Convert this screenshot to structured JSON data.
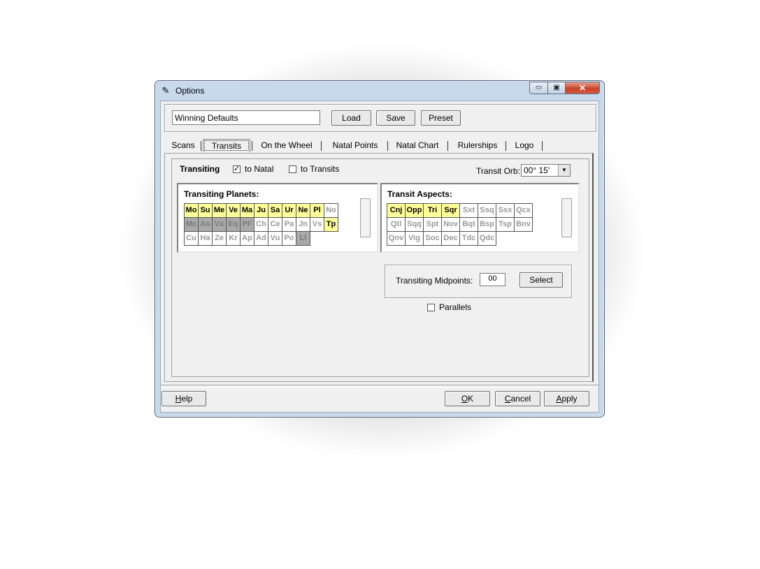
{
  "window": {
    "title": "Options",
    "app_icon": "✎",
    "controls": {
      "minimize": "▭",
      "maximize": "▣",
      "close": "✕"
    }
  },
  "profile": {
    "name_value": "Winning Defaults",
    "load_label": "Load",
    "save_label": "Save",
    "preset_label": "Preset"
  },
  "tabs": [
    "Scans",
    "Transits",
    "On the Wheel",
    "Natal Points",
    "Natal Chart",
    "Rulerships",
    "Logo"
  ],
  "active_tab": "Transits",
  "transits": {
    "transiting_label": "Transiting",
    "to_natal_label": "to Natal",
    "to_natal_checked": true,
    "to_natal_mark": "✓",
    "to_transits_label": "to Transits",
    "to_transits_checked": false,
    "orb_label": "Transit Orb:",
    "orb_value": "00° 15'",
    "orb_arrow": "▼",
    "planets_title": "Transiting Planets:",
    "planets": [
      [
        {
          "t": "Mo",
          "s": "yellow"
        },
        {
          "t": "Su",
          "s": "yellow"
        },
        {
          "t": "Me",
          "s": "yellow"
        },
        {
          "t": "Ve",
          "s": "yellow"
        },
        {
          "t": "Ma",
          "s": "yellow"
        },
        {
          "t": "Ju",
          "s": "yellow"
        },
        {
          "t": "Sa",
          "s": "yellow"
        },
        {
          "t": "Ur",
          "s": "yellow"
        },
        {
          "t": "Ne",
          "s": "yellow"
        },
        {
          "t": "Pl",
          "s": "yellow"
        },
        {
          "t": "No",
          "s": "white"
        }
      ],
      [
        {
          "t": "Mc",
          "s": "gray"
        },
        {
          "t": "As",
          "s": "gray"
        },
        {
          "t": "Vx",
          "s": "gray"
        },
        {
          "t": "Eq",
          "s": "gray"
        },
        {
          "t": "PF",
          "s": "gray"
        },
        {
          "t": "Ch",
          "s": "white"
        },
        {
          "t": "Ce",
          "s": "white"
        },
        {
          "t": "Pa",
          "s": "white"
        },
        {
          "t": "Jn",
          "s": "white"
        },
        {
          "t": "Vs",
          "s": "white"
        },
        {
          "t": "Tp",
          "s": "yellow"
        }
      ],
      [
        {
          "t": "Cu",
          "s": "white"
        },
        {
          "t": "Ha",
          "s": "white"
        },
        {
          "t": "Ze",
          "s": "white"
        },
        {
          "t": "Kr",
          "s": "white"
        },
        {
          "t": "Ap",
          "s": "white"
        },
        {
          "t": "Ad",
          "s": "white"
        },
        {
          "t": "Vu",
          "s": "white"
        },
        {
          "t": "Po",
          "s": "white"
        },
        {
          "t": "Ll",
          "s": "gray"
        }
      ]
    ],
    "aspects_title": "Transit Aspects:",
    "aspects": [
      [
        {
          "t": "Cnj",
          "s": "yellow"
        },
        {
          "t": "Opp",
          "s": "yellow"
        },
        {
          "t": "Tri",
          "s": "yellow"
        },
        {
          "t": "Sqr",
          "s": "yellow"
        },
        {
          "t": "Sxt",
          "s": "white"
        },
        {
          "t": "Ssq",
          "s": "white"
        },
        {
          "t": "Ssx",
          "s": "white"
        },
        {
          "t": "Qcx",
          "s": "white"
        }
      ],
      [
        {
          "t": "Qtl",
          "s": "white"
        },
        {
          "t": "Sqq",
          "s": "white"
        },
        {
          "t": "Spt",
          "s": "white"
        },
        {
          "t": "Nov",
          "s": "white"
        },
        {
          "t": "Bqt",
          "s": "white"
        },
        {
          "t": "Bsp",
          "s": "white"
        },
        {
          "t": "Tsp",
          "s": "white"
        },
        {
          "t": "Bnv",
          "s": "white"
        }
      ],
      [
        {
          "t": "Qnv",
          "s": "white"
        },
        {
          "t": "Vig",
          "s": "white"
        },
        {
          "t": "Soc",
          "s": "white"
        },
        {
          "t": "Dec",
          "s": "white"
        },
        {
          "t": "Tdc",
          "s": "white"
        },
        {
          "t": "Qdc",
          "s": "white"
        }
      ]
    ],
    "midpoints_label": "Transiting Midpoints:",
    "midpoints_value": "00",
    "select_label": "Select",
    "parallels_label": "Parallels",
    "parallels_checked": false
  },
  "footer": {
    "help": {
      "hot": "H",
      "rest": "elp"
    },
    "ok": {
      "hot": "O",
      "rest": "K"
    },
    "cancel": {
      "hot": "C",
      "rest": "ancel"
    },
    "apply": {
      "hot": "A",
      "rest": "pply"
    }
  },
  "colors": {
    "selected": "#ffff99",
    "disabled": "#a9a9a9",
    "off": "#ffffff"
  }
}
